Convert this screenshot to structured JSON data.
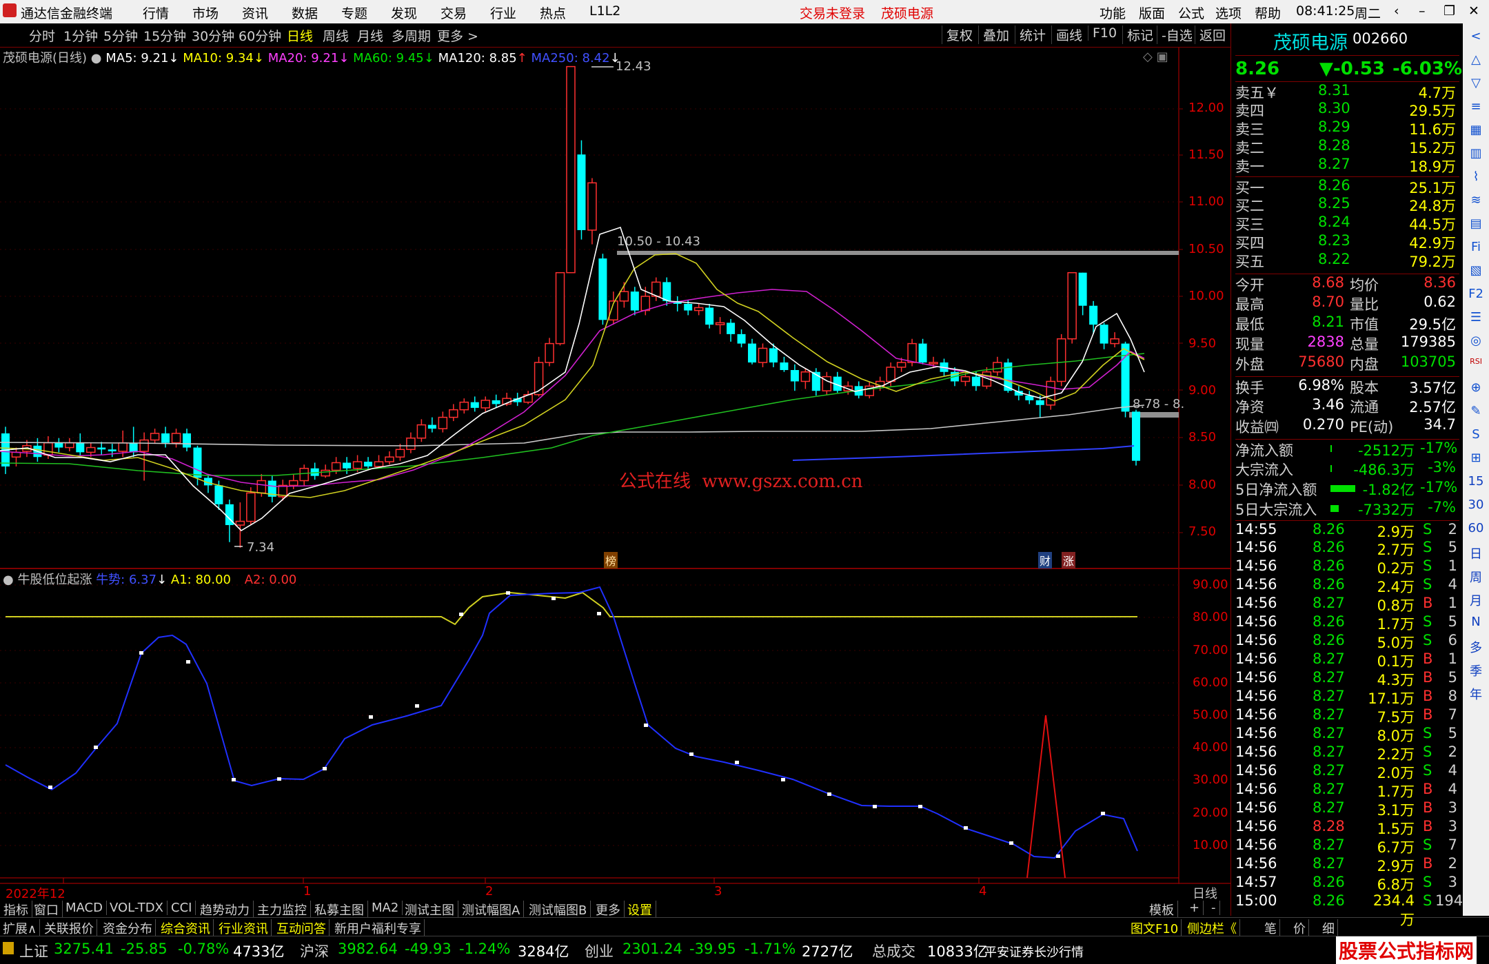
{
  "app": {
    "title": "通达信金融终端",
    "menu": [
      "行情",
      "市场",
      "资讯",
      "数据",
      "专题",
      "发现",
      "交易",
      "行业",
      "热点",
      "L1L2"
    ],
    "login_status": "交易未登录",
    "stock_name_title": "茂硕电源",
    "right_menu": [
      "功能",
      "版面",
      "公式",
      "选项",
      "帮助"
    ],
    "clock": "08:41:25",
    "weekday": "周二"
  },
  "toolbar": {
    "periods": [
      "分时",
      "1分钟",
      "5分钟",
      "15分钟",
      "30分钟",
      "60分钟",
      "日线",
      "周线",
      "月线",
      "多周期",
      "更多 >"
    ],
    "selected": "日线",
    "right_buttons": [
      "复权",
      "叠加",
      "统计",
      "画线",
      "F10",
      "标记",
      "-自选",
      "返回"
    ]
  },
  "main_chart": {
    "header": {
      "name": "茂硕电源(日线)",
      "ma5": "MA5: 9.21",
      "ma10": "MA10: 9.34",
      "ma20": "MA20: 9.21",
      "ma60": "MA60: 9.45",
      "ma120": "MA120: 8.85",
      "ma250": "MA250: 8.42"
    },
    "price_axis": [
      "12.00",
      "11.50",
      "11.00",
      "10.50",
      "10.00",
      "9.50",
      "9.00",
      "8.50",
      "8.00",
      "7.50"
    ],
    "annotations": {
      "high": "12.43",
      "low": "7.34",
      "range1": "10.50 - 10.43",
      "range2": "8.78 - 8.",
      "watermark": "公式在线  www.gszx.com.cn",
      "tag_bang": "榜",
      "tag_cai": "财",
      "tag_zhang": "涨"
    }
  },
  "indicator": {
    "header": {
      "name": "牛股低位起涨",
      "niu": "牛势: 6.37",
      "a1": "A1: 80.00",
      "a2": "A2: 0.00"
    },
    "axis": [
      "90.00",
      "80.00",
      "70.00",
      "60.00",
      "50.00",
      "40.00",
      "30.00",
      "20.00",
      "10.00"
    ]
  },
  "date_axis": {
    "labels": [
      "2022年12",
      "1",
      "2",
      "3",
      "4"
    ],
    "period_label": "日线"
  },
  "bottom_tabs": [
    "指标",
    "窗口",
    "MACD",
    "VOL-TDX",
    "CCI",
    "趋势动力",
    "主力监控",
    "私募主图",
    "MA2",
    "测试主图",
    "测试幅图A",
    "测试幅图B",
    "更多",
    "设置"
  ],
  "bottom_right": {
    "moban": "模板",
    "plus": "+",
    "minus": "-"
  },
  "bottom_tabs2": [
    "扩展∧",
    "关联报价",
    "资金分布",
    "综合资讯",
    "行业资讯",
    "互动问答",
    "新用户福利专享"
  ],
  "bottom_tabs2_right": [
    "图文F10",
    "侧边栏《",
    "笔",
    "价",
    "细"
  ],
  "quote": {
    "name": "茂硕电源",
    "code": "002660",
    "price": "8.26",
    "change": "▼-0.53",
    "pct": "-6.03%",
    "asks": [
      {
        "label": "卖五￥",
        "price": "8.31",
        "vol": "4.7万"
      },
      {
        "label": "卖四",
        "price": "8.30",
        "vol": "29.5万"
      },
      {
        "label": "卖三",
        "price": "8.29",
        "vol": "11.6万"
      },
      {
        "label": "卖二",
        "price": "8.28",
        "vol": "15.2万"
      },
      {
        "label": "卖一",
        "price": "8.27",
        "vol": "18.9万"
      }
    ],
    "bids": [
      {
        "label": "买一",
        "price": "8.26",
        "vol": "25.1万"
      },
      {
        "label": "买二",
        "price": "8.25",
        "vol": "24.8万"
      },
      {
        "label": "买三",
        "price": "8.24",
        "vol": "44.5万"
      },
      {
        "label": "买四",
        "price": "8.23",
        "vol": "42.9万"
      },
      {
        "label": "买五",
        "price": "8.22",
        "vol": "79.2万"
      }
    ],
    "stats": [
      {
        "l1": "今开",
        "v1": "8.68",
        "l2": "均价",
        "v2": "8.36"
      },
      {
        "l1": "最高",
        "v1": "8.70",
        "l2": "量比",
        "v2": "0.62"
      },
      {
        "l1": "最低",
        "v1": "8.21",
        "l2": "市值",
        "v2": "29.5亿"
      },
      {
        "l1": "现量",
        "v1": "2838",
        "l2": "总量",
        "v2": "179385"
      },
      {
        "l1": "外盘",
        "v1": "75680",
        "l2": "内盘",
        "v2": "103705"
      }
    ],
    "stats2": [
      {
        "l1": "换手",
        "v1": "6.98%",
        "l2": "股本",
        "v2": "3.57亿"
      },
      {
        "l1": "净资",
        "v1": "3.46",
        "l2": "流通",
        "v2": "2.57亿"
      },
      {
        "l1": "收益㈣",
        "v1": "0.270",
        "l2": "PE(动)",
        "v2": "34.7"
      }
    ],
    "flows": [
      {
        "label": "净流入额",
        "val": "-2512万",
        "pct": "-17%"
      },
      {
        "label": "大宗流入",
        "val": "-486.3万",
        "pct": "-3%"
      },
      {
        "label": "5日净流入额",
        "val": "-1.82亿",
        "pct": "-17%"
      },
      {
        "label": "5日大宗流入",
        "val": "-7332万",
        "pct": "-7%"
      }
    ],
    "ticks": [
      {
        "t": "14:55",
        "p": "8.26",
        "v": "2.9万",
        "d": "S",
        "n": "2"
      },
      {
        "t": "14:56",
        "p": "8.26",
        "v": "2.7万",
        "d": "S",
        "n": "5"
      },
      {
        "t": "14:56",
        "p": "8.26",
        "v": "0.2万",
        "d": "S",
        "n": "1"
      },
      {
        "t": "14:56",
        "p": "8.26",
        "v": "2.4万",
        "d": "S",
        "n": "4"
      },
      {
        "t": "14:56",
        "p": "8.27",
        "v": "0.8万",
        "d": "B",
        "n": "1"
      },
      {
        "t": "14:56",
        "p": "8.26",
        "v": "1.7万",
        "d": "S",
        "n": "5"
      },
      {
        "t": "14:56",
        "p": "8.26",
        "v": "5.0万",
        "d": "S",
        "n": "6"
      },
      {
        "t": "14:56",
        "p": "8.27",
        "v": "0.1万",
        "d": "B",
        "n": "1"
      },
      {
        "t": "14:56",
        "p": "8.27",
        "v": "4.3万",
        "d": "B",
        "n": "5"
      },
      {
        "t": "14:56",
        "p": "8.27",
        "v": "17.1万",
        "d": "B",
        "n": "8"
      },
      {
        "t": "14:56",
        "p": "8.27",
        "v": "7.5万",
        "d": "B",
        "n": "7"
      },
      {
        "t": "14:56",
        "p": "8.27",
        "v": "8.0万",
        "d": "S",
        "n": "5"
      },
      {
        "t": "14:56",
        "p": "8.27",
        "v": "2.2万",
        "d": "S",
        "n": "2"
      },
      {
        "t": "14:56",
        "p": "8.27",
        "v": "2.0万",
        "d": "S",
        "n": "4"
      },
      {
        "t": "14:56",
        "p": "8.27",
        "v": "1.7万",
        "d": "B",
        "n": "4"
      },
      {
        "t": "14:56",
        "p": "8.27",
        "v": "3.1万",
        "d": "B",
        "n": "3"
      },
      {
        "t": "14:56",
        "p": "8.28",
        "v": "1.5万",
        "d": "B",
        "n": "3"
      },
      {
        "t": "14:56",
        "p": "8.27",
        "v": "6.7万",
        "d": "S",
        "n": "7"
      },
      {
        "t": "14:56",
        "p": "8.27",
        "v": "2.9万",
        "d": "B",
        "n": "2"
      },
      {
        "t": "14:57",
        "p": "8.26",
        "v": "6.8万",
        "d": "S",
        "n": "3"
      },
      {
        "t": "15:00",
        "p": "8.26",
        "v": "234.4万",
        "d": "S",
        "n": "194"
      }
    ]
  },
  "sidebar_icons": [
    "<",
    "△",
    "▽",
    "≡",
    "▦",
    "▥",
    "⌇",
    "≋",
    "▤",
    "Fi",
    "▧",
    "F2",
    "☰",
    "◎",
    "RSI",
    "⊕",
    "✎",
    "S",
    "⊞",
    "15",
    "30",
    "60",
    "日",
    "周",
    "月",
    "N",
    "多",
    "季",
    "年"
  ],
  "statusbar": [
    {
      "label": "上证",
      "val": "3275.41",
      "chg": "-25.85",
      "pct": "-0.78%",
      "amt": "4733亿"
    },
    {
      "label": "沪深",
      "val": "3982.64",
      "chg": "-49.93",
      "pct": "-1.24%",
      "amt": "3284亿"
    },
    {
      "label": "创业",
      "val": "2301.24",
      "chg": "-39.95",
      "pct": "-1.71%",
      "amt": "2727亿"
    }
  ],
  "status_total": {
    "label": "总成交",
    "val": "10833亿",
    "note": "平安证券长沙行情"
  },
  "brand": "股票公式指标网"
}
